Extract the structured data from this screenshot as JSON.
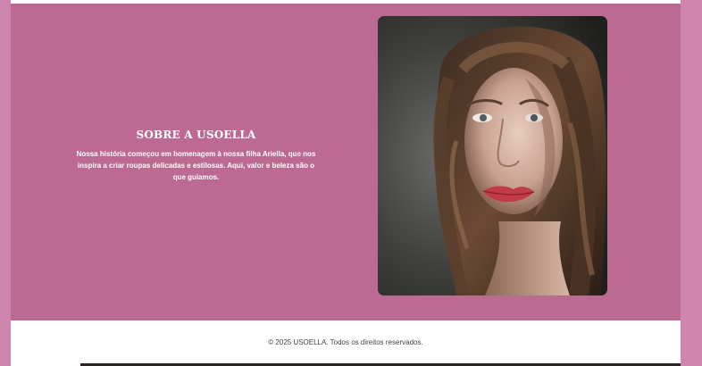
{
  "about": {
    "title": "SOBRE A USOELLA",
    "body": "Nossa história começou em homenagem à nossa filha Ariella, que nos inspira a criar roupas delicadas e estilosas. Aqui, valor e beleza são o que guiamos."
  },
  "footer": {
    "copyright": "© 2025 USOELLA. Todos os direitos reservados."
  },
  "colors": {
    "page_background": "#cf86ae",
    "section_background": "#bd6a93",
    "surface": "#ffffff",
    "text_on_section": "#ffffff",
    "footer_text": "#444444"
  }
}
